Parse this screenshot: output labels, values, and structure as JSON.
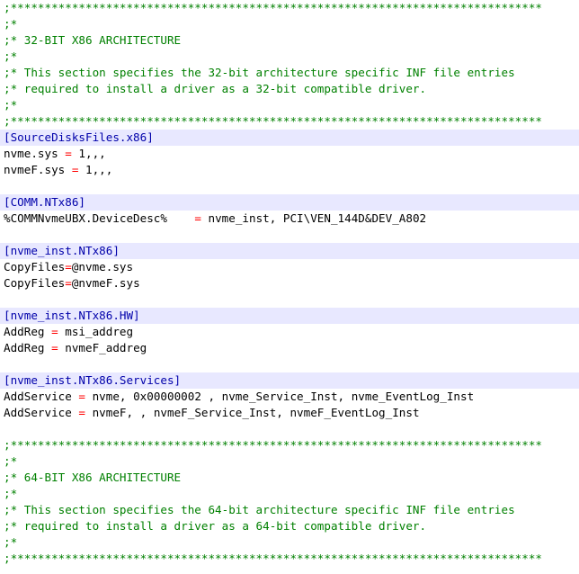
{
  "colors": {
    "comment": "#008000",
    "section": "#0000aa",
    "section_background": "#e8e8ff",
    "operator": "#ff0000",
    "text": "#000000",
    "background": "#ffffff"
  },
  "lines": [
    {
      "kind": "comment",
      "text": ";******************************************************************************"
    },
    {
      "kind": "comment",
      "text": ";*"
    },
    {
      "kind": "comment",
      "text": ";* 32-BIT X86 ARCHITECTURE"
    },
    {
      "kind": "comment",
      "text": ";*"
    },
    {
      "kind": "comment",
      "text": ";* This section specifies the 32-bit architecture specific INF file entries"
    },
    {
      "kind": "comment",
      "text": ";* required to install a driver as a 32-bit compatible driver."
    },
    {
      "kind": "comment",
      "text": ";*"
    },
    {
      "kind": "comment",
      "text": ";******************************************************************************"
    },
    {
      "kind": "section",
      "text": "[SourceDisksFiles.x86]"
    },
    {
      "kind": "code",
      "key": "nvme.sys ",
      "op": "=",
      "value": " 1,,,"
    },
    {
      "kind": "code",
      "key": "nvmeF.sys ",
      "op": "=",
      "value": " 1,,,"
    },
    {
      "kind": "blank",
      "text": ""
    },
    {
      "kind": "section",
      "text": "[COMM.NTx86]"
    },
    {
      "kind": "code",
      "key": "%COMMNvmeUBX.DeviceDesc%    ",
      "op": "=",
      "value": " nvme_inst, PCI\\VEN_144D&DEV_A802"
    },
    {
      "kind": "blank",
      "text": ""
    },
    {
      "kind": "section",
      "text": "[nvme_inst.NTx86]"
    },
    {
      "kind": "code",
      "key": "CopyFiles",
      "op": "=",
      "value": "@nvme.sys"
    },
    {
      "kind": "code",
      "key": "CopyFiles",
      "op": "=",
      "value": "@nvmeF.sys"
    },
    {
      "kind": "blank",
      "text": ""
    },
    {
      "kind": "section",
      "text": "[nvme_inst.NTx86.HW]"
    },
    {
      "kind": "code",
      "key": "AddReg ",
      "op": "=",
      "value": " msi_addreg"
    },
    {
      "kind": "code",
      "key": "AddReg ",
      "op": "=",
      "value": " nvmeF_addreg"
    },
    {
      "kind": "blank",
      "text": ""
    },
    {
      "kind": "section",
      "text": "[nvme_inst.NTx86.Services]"
    },
    {
      "kind": "code",
      "key": "AddService ",
      "op": "=",
      "value": " nvme, 0x00000002 , nvme_Service_Inst, nvme_EventLog_Inst"
    },
    {
      "kind": "code",
      "key": "AddService ",
      "op": "=",
      "value": " nvmeF, , nvmeF_Service_Inst, nvmeF_EventLog_Inst"
    },
    {
      "kind": "blank",
      "text": ""
    },
    {
      "kind": "comment",
      "text": ";******************************************************************************"
    },
    {
      "kind": "comment",
      "text": ";*"
    },
    {
      "kind": "comment",
      "text": ";* 64-BIT X86 ARCHITECTURE"
    },
    {
      "kind": "comment",
      "text": ";*"
    },
    {
      "kind": "comment",
      "text": ";* This section specifies the 64-bit architecture specific INF file entries"
    },
    {
      "kind": "comment",
      "text": ";* required to install a driver as a 64-bit compatible driver."
    },
    {
      "kind": "comment",
      "text": ";*"
    },
    {
      "kind": "comment",
      "text": ";******************************************************************************"
    }
  ]
}
